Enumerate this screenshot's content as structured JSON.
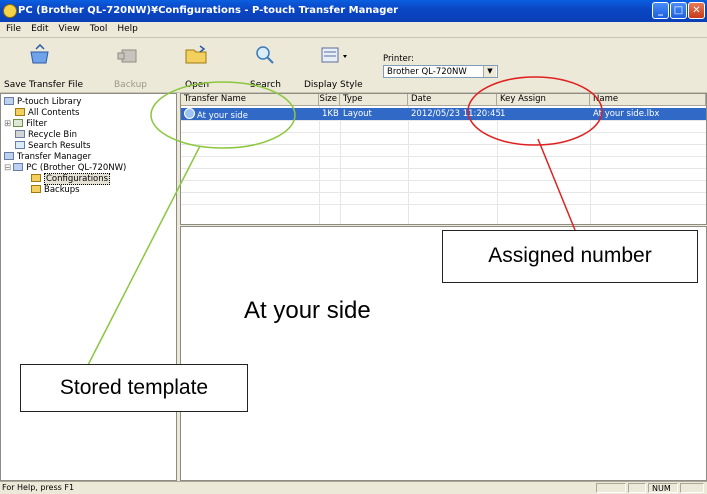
{
  "window": {
    "title": "PC (Brother QL-720NW)¥Configurations - P-touch Transfer Manager"
  },
  "menu": [
    "File",
    "Edit",
    "View",
    "Tool",
    "Help"
  ],
  "toolbar": {
    "save": "Save Transfer File",
    "backup": "Backup",
    "open": "Open",
    "search": "Search",
    "display_style": "Display Style",
    "printer_label": "Printer:",
    "printer_value": "Brother QL-720NW"
  },
  "tree": {
    "library": "P-touch Library",
    "all_contents": "All Contents",
    "filter": "Filter",
    "recycle_bin": "Recycle Bin",
    "search_results": "Search Results",
    "transfer_manager": "Transfer Manager",
    "pc": "PC (Brother QL-720NW)",
    "configurations": "Configurations",
    "backups": "Backups"
  },
  "table": {
    "columns": [
      "Transfer Name",
      "Size",
      "Type",
      "Date",
      "Key Assign",
      "Name"
    ],
    "rows": [
      {
        "name": "At your side",
        "size": "1KB",
        "type": "Layout",
        "date": "2012/05/23 11:20:45",
        "key": "1",
        "file": "At your side.lbx"
      }
    ]
  },
  "preview": {
    "text": "At your side"
  },
  "status": {
    "help": "For Help, press F1",
    "num": "NUM"
  },
  "callouts": {
    "assigned": "Assigned number",
    "stored": "Stored template"
  },
  "colors": {
    "selection": "#3169c6",
    "green_annotation": "#8cc63f",
    "red_annotation": "#e02020"
  }
}
